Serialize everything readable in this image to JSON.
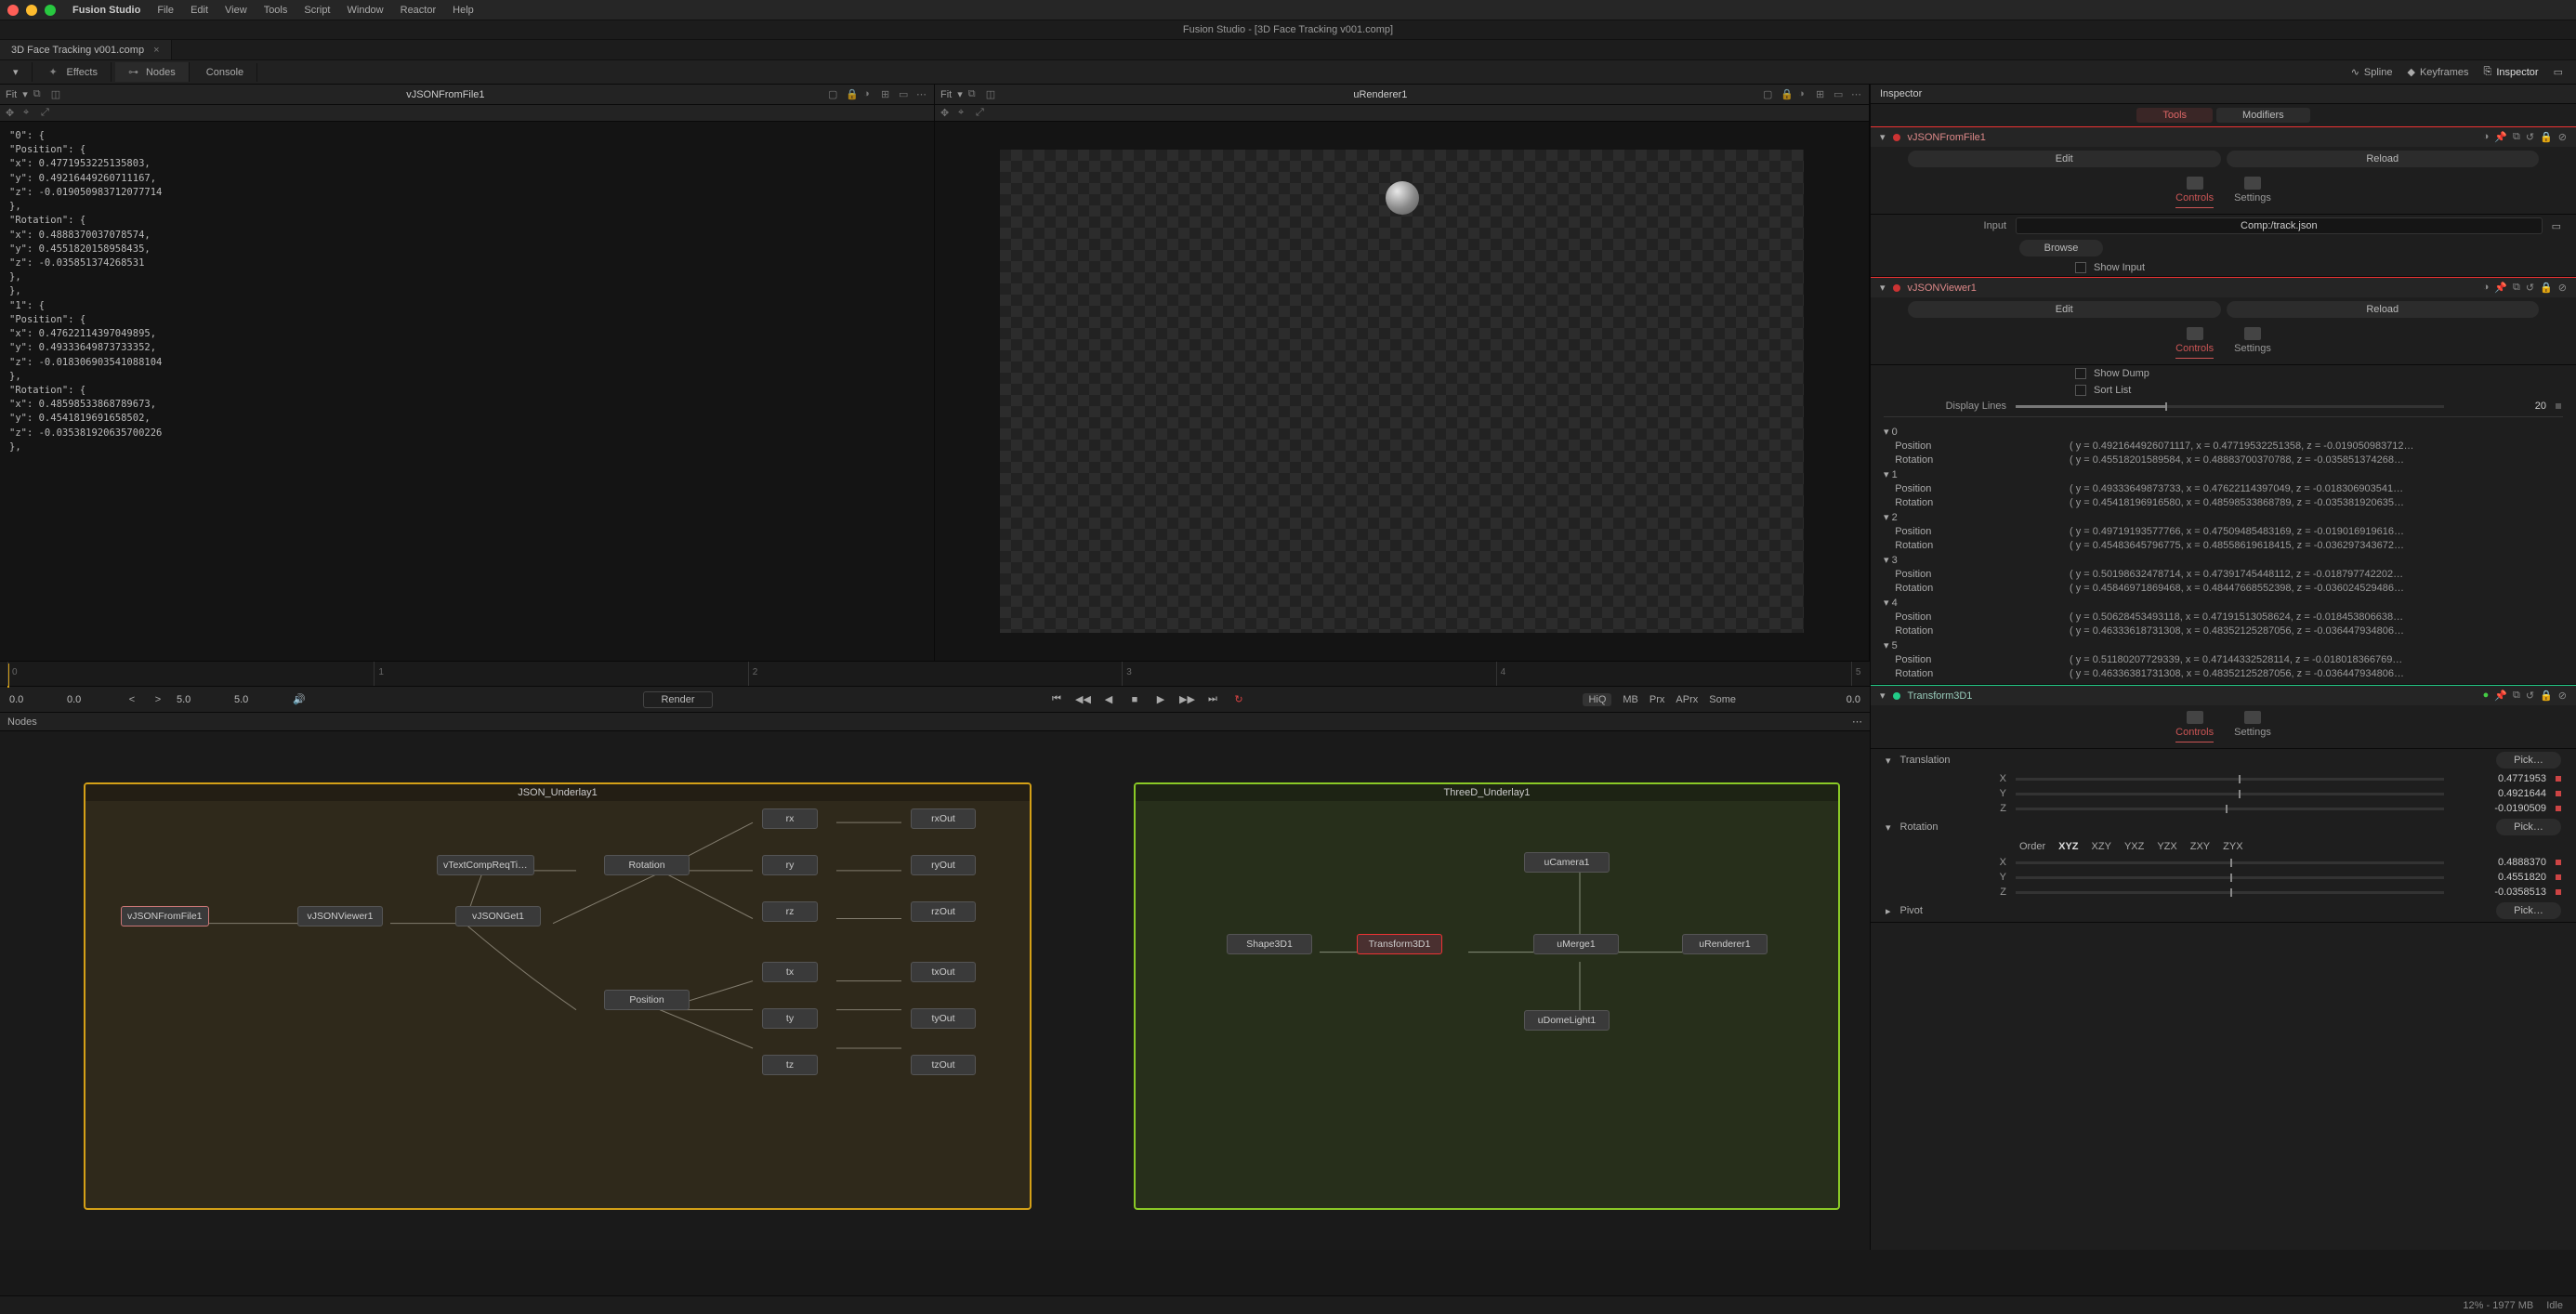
{
  "menubar": {
    "app": "Fusion Studio",
    "items": [
      "File",
      "Edit",
      "View",
      "Tools",
      "Script",
      "Window",
      "Reactor",
      "Help"
    ]
  },
  "window_title": "Fusion Studio - [3D Face Tracking v001.comp]",
  "tab": {
    "name": "3D Face Tracking v001.comp"
  },
  "subbar": {
    "effects": "Effects",
    "nodes": "Nodes",
    "console": "Console",
    "spline": "Spline",
    "keyframes": "Keyframes",
    "inspector": "Inspector"
  },
  "viewer1": {
    "fit": "Fit",
    "name": "vJSONFromFile1",
    "json_dump": "\"0\": {\n\"Position\": {\n\"x\": 0.4771953225135803,\n\"y\": 0.49216449260711167,\n\"z\": -0.019050983712077714\n},\n\"Rotation\": {\n\"x\": 0.4888370037078574,\n\"y\": 0.4551820158958435,\n\"z\": -0.035851374268531\n},\n},\n\"1\": {\n\"Position\": {\n\"x\": 0.47622114397049895,\n\"y\": 0.49333649873733352,\n\"z\": -0.018306903541088104\n},\n\"Rotation\": {\n\"x\": 0.48598533868789673,\n\"y\": 0.4541819691658502,\n\"z\": -0.035381920635700226\n},"
  },
  "viewer2": {
    "fit": "Fit",
    "name": "uRenderer1"
  },
  "timeline": {
    "ticks": [
      "0",
      "1",
      "2",
      "3",
      "4",
      "5"
    ]
  },
  "transport": {
    "start": "0.0",
    "in": "0.0",
    "out": "5.0",
    "end": "5.0",
    "render": "Render",
    "labels": [
      "HiQ",
      "MB",
      "Prx",
      "APrx",
      "Some"
    ],
    "current": "0.0"
  },
  "nodepanel": {
    "title": "Nodes"
  },
  "underlays": {
    "json": "JSON_Underlay1",
    "threed": "ThreeD_Underlay1"
  },
  "nodes": {
    "json": [
      "vJSONFromFile1",
      "vJSONViewer1",
      "vJSONGet1",
      "vTextCompReqTi…",
      "Rotation",
      "Position",
      "rx",
      "ry",
      "rz",
      "tx",
      "ty",
      "tz",
      "rxOut",
      "ryOut",
      "rzOut",
      "txOut",
      "tyOut",
      "tzOut"
    ],
    "threed": [
      "uCamera1",
      "Shape3D1",
      "Transform3D1",
      "uMerge1",
      "uDomeLight1",
      "uRenderer1"
    ]
  },
  "inspector": {
    "title": "Inspector",
    "tabs": {
      "tools": "Tools",
      "modifiers": "Modifiers"
    },
    "tool1": {
      "name": "vJSONFromFile1",
      "edit": "Edit",
      "reload": "Reload",
      "controls": "Controls",
      "settings": "Settings",
      "input_lbl": "Input",
      "input_val": "Comp:/track.json",
      "browse": "Browse",
      "show_input": "Show Input"
    },
    "tool2": {
      "name": "vJSONViewer1",
      "edit": "Edit",
      "reload": "Reload",
      "controls": "Controls",
      "settings": "Settings",
      "show_dump": "Show Dump",
      "sort_list": "Sort List",
      "display_lines_lbl": "Display Lines",
      "display_lines_val": "20",
      "rows": [
        {
          "i": "0",
          "pos": "( y = 0.4921644926071117, x = 0.47719532251358, z = -0.019050983712…",
          "rot": "( y = 0.45518201589584, x = 0.48883700370788, z = -0.035851374268…"
        },
        {
          "i": "1",
          "pos": "( y = 0.49333649873733, x = 0.47622114397049, z = -0.018306903541…",
          "rot": "( y = 0.45418196916580, x = 0.48598533868789, z = -0.035381920635…"
        },
        {
          "i": "2",
          "pos": "( y = 0.49719193577766, x = 0.47509485483169, z = -0.019016919616…",
          "rot": "( y = 0.45483645796775, x = 0.48558619618415, z = -0.036297343672…"
        },
        {
          "i": "3",
          "pos": "( y = 0.50198632478714, x = 0.47391745448112, z = -0.018797742202…",
          "rot": "( y = 0.45846971869468, x = 0.48447668552398, z = -0.036024529486…"
        },
        {
          "i": "4",
          "pos": "( y = 0.50628453493118, x = 0.47191513058624, z = -0.018453806638…",
          "rot": "( y = 0.46333618731308, x = 0.48352125287056, z = -0.036447934806…"
        },
        {
          "i": "5",
          "pos": "( y = 0.51180207729339, x = 0.47144332528114, z = -0.018018366769…",
          "rot": "( y = 0.46336381731308, x = 0.48352125287056, z = -0.036447934806…"
        }
      ],
      "row_labels": {
        "position": "Position",
        "rotation": "Rotation"
      }
    },
    "tool3": {
      "name": "Transform3D1",
      "controls": "Controls",
      "settings": "Settings",
      "translation": "Translation",
      "rotation": "Rotation",
      "pivot": "Pivot",
      "pick": "Pick…",
      "order_lbl": "Order",
      "orders": [
        "XYZ",
        "XZY",
        "YXZ",
        "YZX",
        "ZXY",
        "ZYX"
      ],
      "x": "X",
      "y": "Y",
      "z": "Z",
      "tx": "0.4771953",
      "ty": "0.4921644",
      "tz": "-0.0190509",
      "rx": "0.4888370",
      "ry": "0.4551820",
      "rz": "-0.0358513"
    }
  },
  "status": {
    "mem": "12% - 1977 MB",
    "state": "Idle"
  }
}
